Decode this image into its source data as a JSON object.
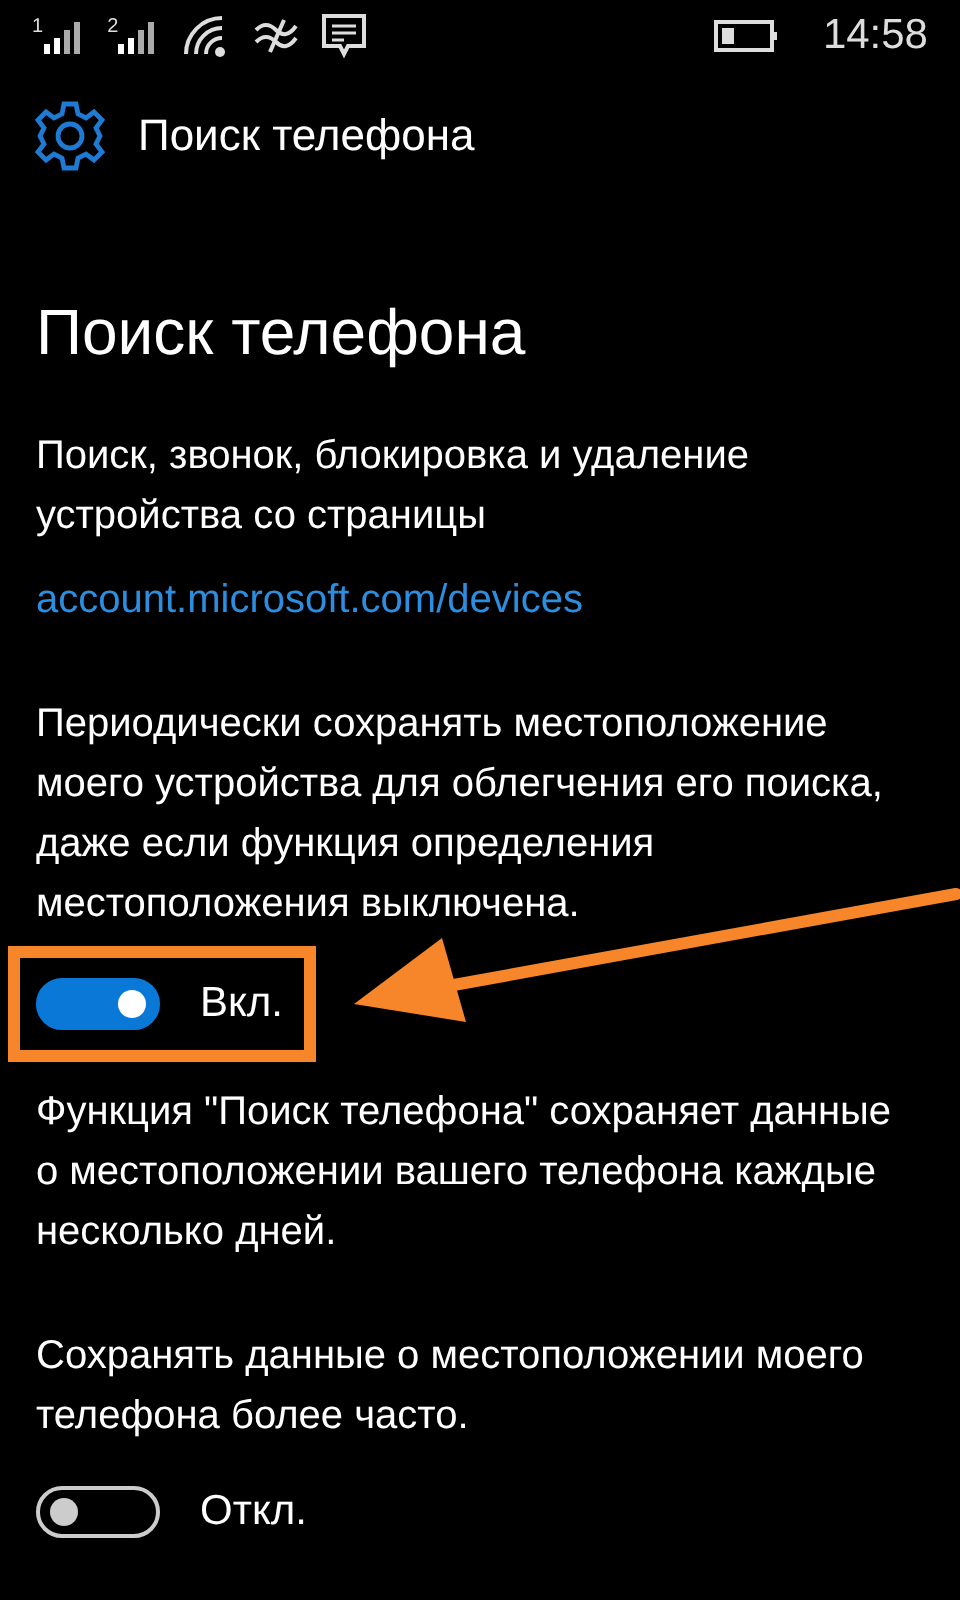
{
  "status_bar": {
    "sims": [
      "1",
      "2"
    ],
    "time": "14:58"
  },
  "header": {
    "title": "Поиск телефона"
  },
  "page_title": "Поиск телефона",
  "sections": [
    {
      "kind": "text",
      "text": "Поиск, звонок, блокировка и удаление устройства со страницы"
    },
    {
      "kind": "link",
      "text": "account.microsoft.com/devices"
    },
    {
      "kind": "text",
      "text": "Периодически сохранять местоположение моего устройства для облегчения его поиска, даже если функция определения местоположения выключена."
    },
    {
      "kind": "toggle",
      "on": true,
      "label": "Вкл.",
      "highlighted": true
    },
    {
      "kind": "text",
      "text": "Функция \"Поиск телефона\" сохраняет данные о местоположении вашего телефона каждые несколько дней."
    },
    {
      "kind": "text",
      "text": " Сохранять данные о местоположении моего телефона более часто."
    },
    {
      "kind": "toggle",
      "on": false,
      "label": "Откл.",
      "highlighted": false
    }
  ]
}
